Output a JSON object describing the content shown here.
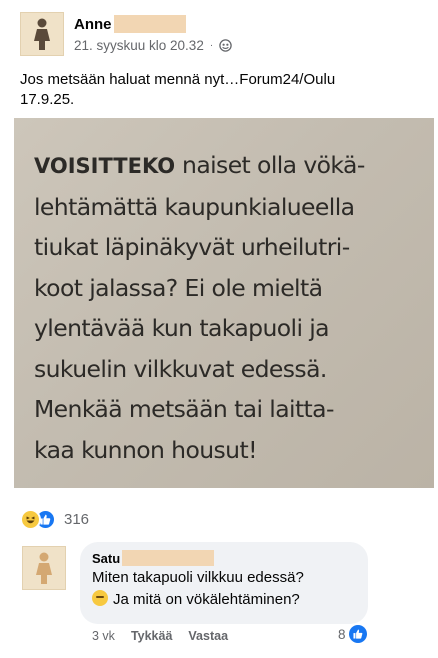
{
  "post": {
    "author_name": "Anne",
    "timestamp": "21. syyskuu klo 20.32",
    "separator": "·",
    "text_line1": "Jos metsään haluat mennä nyt…Forum24/Oulu",
    "text_line2": "17.9.25."
  },
  "photo": {
    "lead_word": "VOISITTEKO",
    "line1_rest": " naiset olla vökä-",
    "line2": "lehtämättä kaupunkialueella",
    "line3": "tiukat läpinäkyvät urheilutri-",
    "line4": "koot jalassa? Ei ole mieltä",
    "line5": "ylentävää kun takapuoli ja",
    "line6": "sukuelin vilkkuvat edessä.",
    "line7": "Menkää metsään tai laitta-",
    "line8": "kaa kunnon housut!"
  },
  "reactions": {
    "count": "316",
    "types": [
      "haha-icon",
      "like-icon"
    ]
  },
  "comment": {
    "author_name": "Satu",
    "line1": "Miten takapuoli vilkkuu edessä?",
    "line2": "Ja mitä on vökälehtäminen?",
    "time": "3 vk",
    "like_label": "Tykkää",
    "reply_label": "Vastaa",
    "reaction_count": "8"
  },
  "colors": {
    "accent": "#1877f2",
    "muted_text": "#65676b",
    "bubble": "#f0f2f5",
    "redaction": "#f2d6b3"
  }
}
